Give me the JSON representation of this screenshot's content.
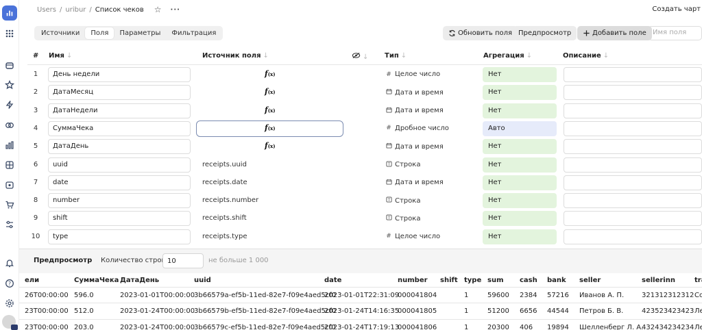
{
  "breadcrumb": {
    "users": "Users",
    "sep": "/",
    "user": "uribur",
    "current": "Список чеков"
  },
  "topbar": {
    "create_chart": "Создать чарт"
  },
  "tabs": [
    "Источники",
    "Поля",
    "Параметры",
    "Фильтрация"
  ],
  "active_tab": "Поля",
  "toolbar": {
    "refresh": "Обновить поля",
    "preview": "Предпросмотр",
    "add_field": "Добавить поле",
    "search_placeholder": "Имя поля"
  },
  "fields_table": {
    "headers": {
      "num": "#",
      "name": "Имя",
      "source": "Источник поля",
      "type": "Тип",
      "aggregation": "Агрегация",
      "description": "Описание"
    },
    "rows": [
      {
        "num": "1",
        "name": "День недели",
        "source": "",
        "formula": true,
        "type": "Целое число",
        "type_icon": "#",
        "agg": "Нет"
      },
      {
        "num": "2",
        "name": "ДатаМесяц",
        "source": "",
        "formula": true,
        "type": "Дата и время",
        "type_icon": "calendar",
        "agg": "Нет"
      },
      {
        "num": "3",
        "name": "ДатаНедели",
        "source": "",
        "formula": true,
        "type": "Дата и время",
        "type_icon": "calendar",
        "agg": "Нет"
      },
      {
        "num": "4",
        "name": "СуммаЧека",
        "source": "",
        "formula": true,
        "type": "Дробное число",
        "type_icon": "#",
        "agg": "Авто"
      },
      {
        "num": "5",
        "name": "ДатаДень",
        "source": "",
        "formula": true,
        "type": "Дата и время",
        "type_icon": "calendar",
        "agg": "Нет"
      },
      {
        "num": "6",
        "name": "uuid",
        "source": "receipts.uuid",
        "formula": false,
        "type": "Строка",
        "type_icon": "string",
        "agg": "Нет"
      },
      {
        "num": "7",
        "name": "date",
        "source": "receipts.date",
        "formula": false,
        "type": "Дата и время",
        "type_icon": "calendar",
        "agg": "Нет"
      },
      {
        "num": "8",
        "name": "number",
        "source": "receipts.number",
        "formula": false,
        "type": "Строка",
        "type_icon": "string",
        "agg": "Нет"
      },
      {
        "num": "9",
        "name": "shift",
        "source": "receipts.shift",
        "formula": false,
        "type": "Строка",
        "type_icon": "string",
        "agg": "Нет"
      },
      {
        "num": "10",
        "name": "type",
        "source": "receipts.type",
        "formula": false,
        "type": "Целое число",
        "type_icon": "#",
        "agg": "Нет"
      }
    ]
  },
  "formula_label": "f",
  "formula_sub": "(x)",
  "preview": {
    "title": "Предпросмотр",
    "count_label": "Количество строк:",
    "count_value": "10",
    "limit": "не больше 1 000",
    "headers": [
      "ели",
      "СуммаЧека",
      "ДатаДень",
      "uuid",
      "date",
      "number",
      "shift",
      "type",
      "sum",
      "cash",
      "bank",
      "seller",
      "sellerinn",
      "tra"
    ],
    "rows": [
      [
        "26T00:00:00",
        "596.0",
        "2023-01-01T00:00:00",
        "3b66579a-ef5b-11ed-82e7-f09e4aed5cf0",
        "2023-01-01T22:31:09",
        "000041804",
        "",
        "1",
        "59600",
        "2384",
        "57216",
        "Иванов А. П.",
        "321312312312",
        "Со"
      ],
      [
        "23T00:00:00",
        "512.0",
        "2023-01-24T00:00:00",
        "3b66579b-ef5b-11ed-82e7-f09e4aed5cf0",
        "2023-01-24T14:16:35",
        "000041805",
        "",
        "1",
        "51200",
        "6656",
        "44544",
        "Петров Б. В.",
        "423523423423",
        "Ле"
      ],
      [
        "23T00:00:00",
        "203.0",
        "2023-01-24T00:00:00",
        "3b66579c-ef5b-11ed-82e7-f09e4aed5cf0",
        "2023-01-24T17:19:13",
        "000041806",
        "",
        "1",
        "20300",
        "406",
        "19894",
        "Шелленберг Л. А.",
        "432434234234",
        "Ле"
      ]
    ]
  }
}
